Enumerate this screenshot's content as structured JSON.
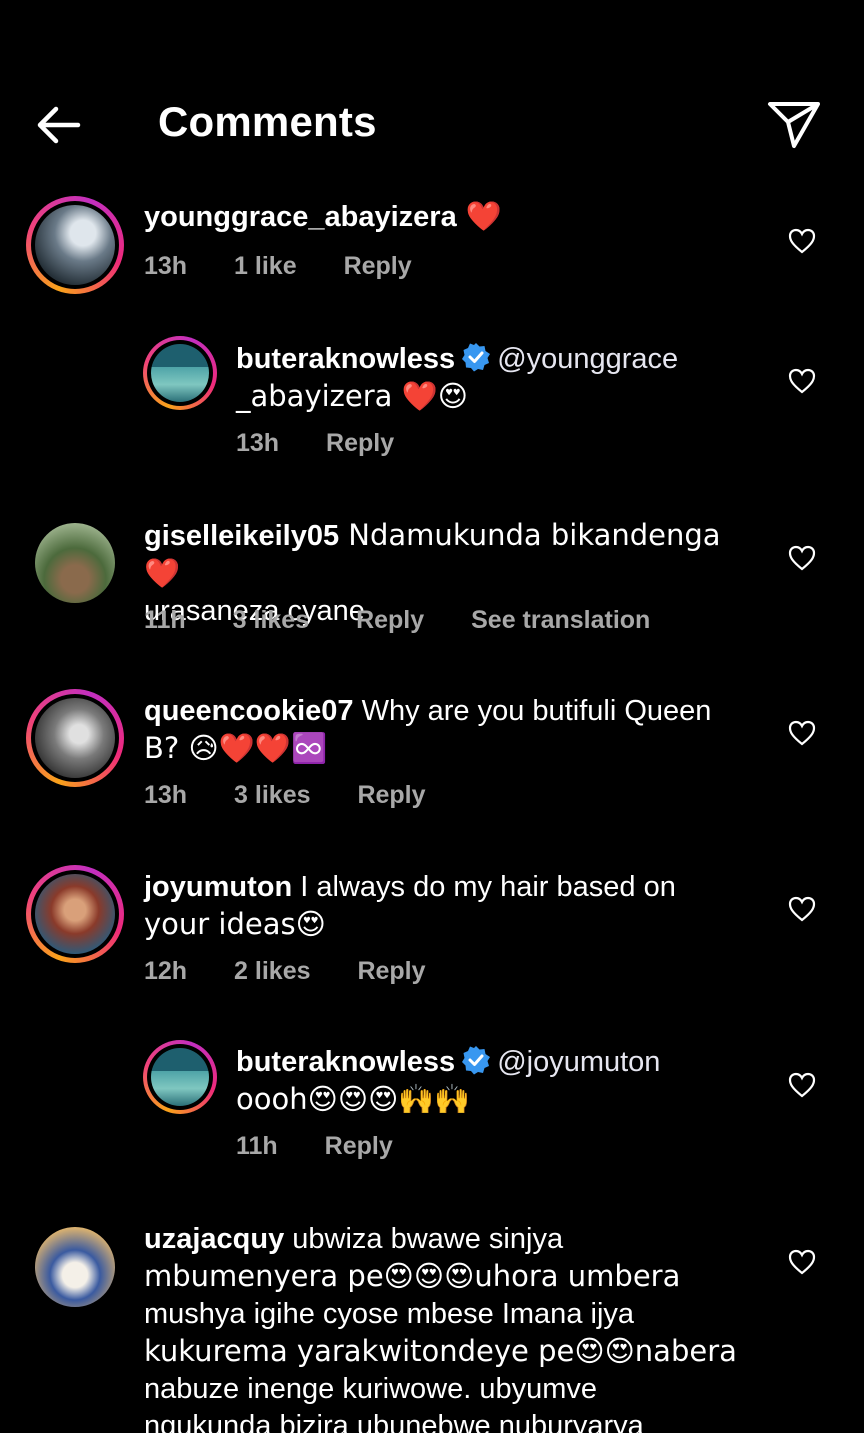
{
  "header": {
    "title": "Comments",
    "back_icon": "arrow-left-icon",
    "share_icon": "paper-plane-icon"
  },
  "comments": [
    {
      "username": "younggrace_abayizera",
      "text": " ❤️",
      "time": "13h",
      "likes": "1 like",
      "reply": "Reply"
    },
    {
      "username": "buteraknowless",
      "mention": "@younggrace",
      "text_line2": "_abayizera ❤️😍",
      "time": "13h",
      "reply": "Reply"
    },
    {
      "username": "giselleikeily05",
      "text": " Ndamukunda bikandenga ❤️",
      "text_line2": "urasaneza cyane",
      "time": "11h",
      "likes": "3 likes",
      "reply": "Reply",
      "translate": "See translation"
    },
    {
      "username": "queencookie07",
      "text": " Why are you butifuli Queen",
      "text_line2": "B? 😥❤️❤️♾️",
      "time": "13h",
      "likes": "3 likes",
      "reply": "Reply"
    },
    {
      "username": "joyumuton",
      "text": " I always do my hair based on",
      "text_line2": "your ideas😍",
      "time": "12h",
      "likes": "2 likes",
      "reply": "Reply"
    },
    {
      "username": "buteraknowless",
      "mention": "@joyumuton",
      "text_line2": "oooh😍😍😍🙌🙌",
      "time": "11h",
      "reply": "Reply"
    },
    {
      "username": "uzajacquy",
      "text": " ubwiza bwawe sinjya",
      "lines": [
        "mbumenyera pe😍😍😍uhora umbera",
        "mushya  igihe cyose mbese Imana ijya",
        "kukurema yarakwitondeye pe😍😍nabera",
        "nabuze inenge kuriwowe. ubyumve",
        "ngukunda bizira ubunebwe nuburyarya"
      ]
    }
  ],
  "colors": {
    "background": "#000000",
    "meta": "#a8a8a8",
    "verified": "#3897f0"
  }
}
